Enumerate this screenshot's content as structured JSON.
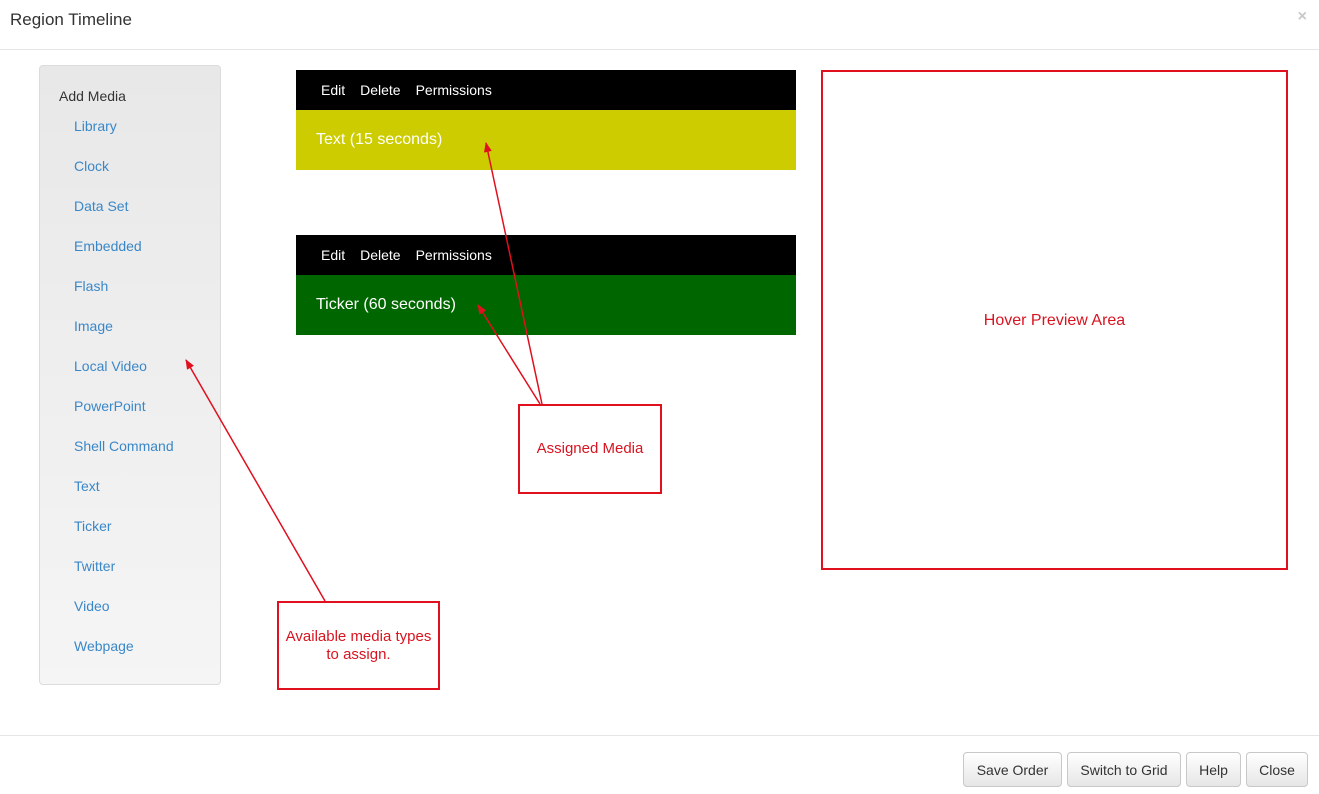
{
  "dialog": {
    "title": "Region Timeline",
    "close_glyph": "×"
  },
  "sidebar": {
    "heading": "Add Media",
    "items": [
      "Library",
      "Clock",
      "Data Set",
      "Embedded",
      "Flash",
      "Image",
      "Local Video",
      "PowerPoint",
      "Shell Command",
      "Text",
      "Ticker",
      "Twitter",
      "Video",
      "Webpage"
    ]
  },
  "timeline": {
    "toolbar": {
      "edit": "Edit",
      "delete": "Delete",
      "permissions": "Permissions"
    },
    "media": [
      {
        "label": "Text (15 seconds)",
        "color": "#cccc00"
      },
      {
        "label": "Ticker (60 seconds)",
        "color": "#006600"
      }
    ]
  },
  "annotations": {
    "preview": "Hover Preview Area",
    "assigned": "Assigned Media",
    "available": "Available media types to assign.",
    "color": "#e0101e"
  },
  "footer": {
    "save_order": "Save Order",
    "switch_grid": "Switch to Grid",
    "help": "Help",
    "close": "Close"
  }
}
